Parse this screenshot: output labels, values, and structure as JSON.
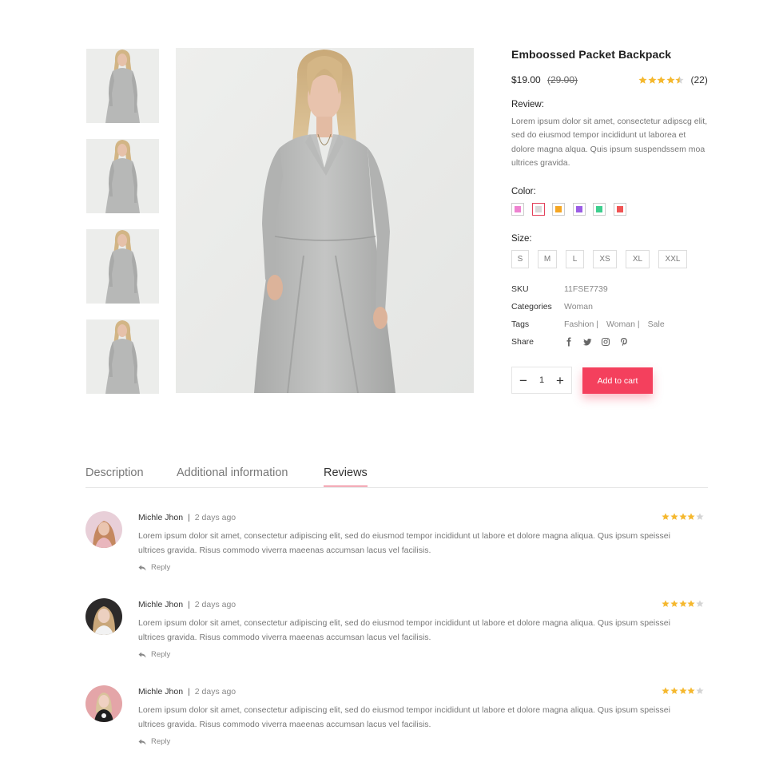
{
  "product": {
    "title": "Emboossed Packet Backpack",
    "price": "$19.00",
    "old_price": "(29.00)",
    "rating_count": "(22)",
    "rating": 4.5,
    "review_label": "Review:",
    "description": "Lorem ipsum dolor sit amet, consectetur adipscg elit, sed do eiusmod tempor incididunt ut laborea et dolore magna alqua. Quis ipsum suspendssem moa ultrices gravida.",
    "color_label": "Color:",
    "colors": [
      "#ee82d0",
      "#d9d9d9",
      "#f5a623",
      "#9b5de5",
      "#3ecf8e",
      "#f05454"
    ],
    "active_color": 1,
    "size_label": "Size:",
    "sizes": [
      "S",
      "M",
      "L",
      "XS",
      "XL",
      "XXL"
    ],
    "sku_key": "SKU",
    "sku_val": "11FSE7739",
    "categories_key": "Categories",
    "categories_val": "Woman",
    "tags_key": "Tags",
    "tags": [
      "Fashion |",
      "Woman |",
      "Sale"
    ],
    "share_key": "Share",
    "share_icons": [
      "facebook-icon",
      "twitter-icon",
      "instagram-icon",
      "pinterest-icon"
    ],
    "quantity": "1",
    "qty_minus": "−",
    "qty_plus": "+",
    "add_to_cart": "Add to cart",
    "accent": "#f4405d"
  },
  "tabs": {
    "description": "Description",
    "additional": "Additional information",
    "reviews": "Reviews",
    "active": "reviews"
  },
  "reviews": [
    {
      "name": "Michle Jhon",
      "separator": "|",
      "date": "2 days ago",
      "rating": 4,
      "text": "Lorem ipsum dolor sit amet, consectetur adipiscing elit, sed do eiusmod tempor incididunt ut labore et dolore magna aliqua. Qus ipsum speissei ultrices gravida. Risus commodo viverra maeenas accumsan lacus vel facilisis.",
      "reply": "Reply"
    },
    {
      "name": "Michle Jhon",
      "separator": "|",
      "date": "2 days ago",
      "rating": 4,
      "text": "Lorem ipsum dolor sit amet, consectetur adipiscing elit, sed do eiusmod tempor incididunt ut labore et dolore magna aliqua. Qus ipsum speissei ultrices gravida. Risus commodo viverra maeenas accumsan lacus vel facilisis.",
      "reply": "Reply"
    },
    {
      "name": "Michle Jhon",
      "separator": "|",
      "date": "2 days ago",
      "rating": 4,
      "text": "Lorem ipsum dolor sit amet, consectetur adipiscing elit, sed do eiusmod tempor incididunt ut labore et dolore magna aliqua. Qus ipsum speissei ultrices gravida. Risus commodo viverra maeenas accumsan lacus vel facilisis.",
      "reply": "Reply"
    }
  ]
}
